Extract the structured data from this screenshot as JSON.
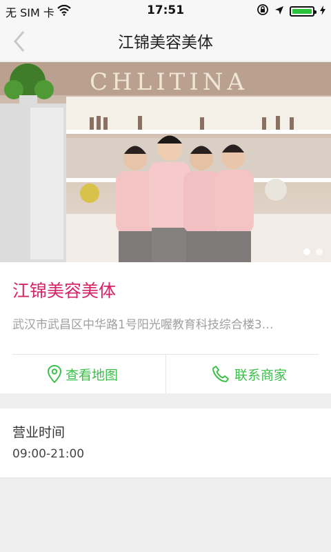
{
  "status_bar": {
    "carrier": "无 SIM 卡",
    "time": "17:51"
  },
  "nav": {
    "title": "江锦美容美体"
  },
  "hero": {
    "sign_text": "CHLITINA",
    "page_count": 2,
    "active_page": 1
  },
  "shop": {
    "name": "江锦美容美体",
    "address": "武汉市武昌区中华路1号阳光喔教育科技综合楼3…"
  },
  "actions": {
    "map_label": "查看地图",
    "contact_label": "联系商家"
  },
  "hours": {
    "label": "营业时间",
    "value": "09:00-21:00"
  },
  "colors": {
    "accent": "#d52466",
    "action": "#3cbf4a"
  }
}
